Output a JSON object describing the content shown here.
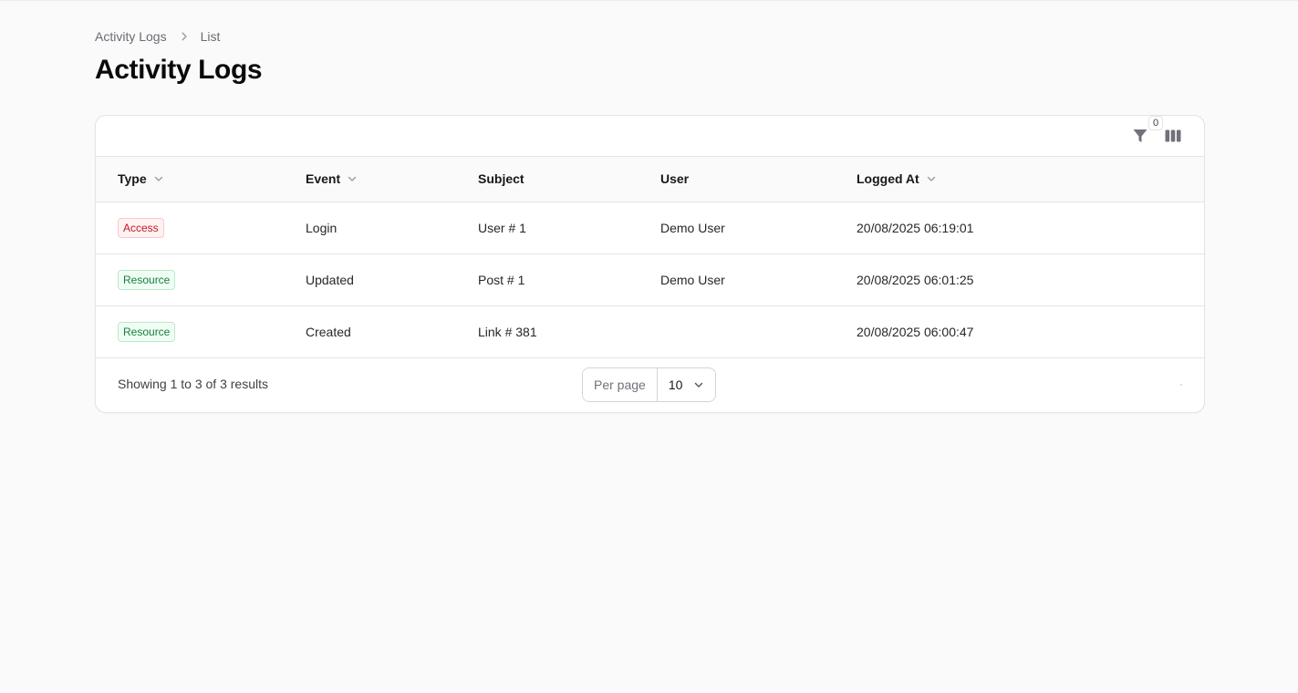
{
  "breadcrumb": {
    "parent": "Activity Logs",
    "current": "List"
  },
  "page": {
    "title": "Activity Logs"
  },
  "toolbar": {
    "filter_count": "0"
  },
  "table": {
    "headers": {
      "type": "Type",
      "event": "Event",
      "subject": "Subject",
      "user": "User",
      "logged_at": "Logged At"
    },
    "rows": [
      {
        "type": "Access",
        "event": "Login",
        "subject": "User # 1",
        "user": "Demo User",
        "logged_at": "20/08/2025 06:19:01"
      },
      {
        "type": "Resource",
        "event": "Updated",
        "subject": "Post # 1",
        "user": "Demo User",
        "logged_at": "20/08/2025 06:01:25"
      },
      {
        "type": "Resource",
        "event": "Created",
        "subject": "Link # 381",
        "user": "",
        "logged_at": "20/08/2025 06:00:47"
      }
    ]
  },
  "footer": {
    "results": "Showing 1 to 3 of 3 results",
    "per_page_label": "Per page",
    "per_page_value": "10"
  },
  "colors": {
    "access_badge": "#c2182b",
    "resource_badge": "#15803d",
    "background": "#fafafa"
  },
  "icons": {
    "breadcrumb_separator": "chevron-right-icon",
    "filter": "funnel-icon",
    "columns": "columns-icon",
    "sort": "chevron-down-icon"
  }
}
